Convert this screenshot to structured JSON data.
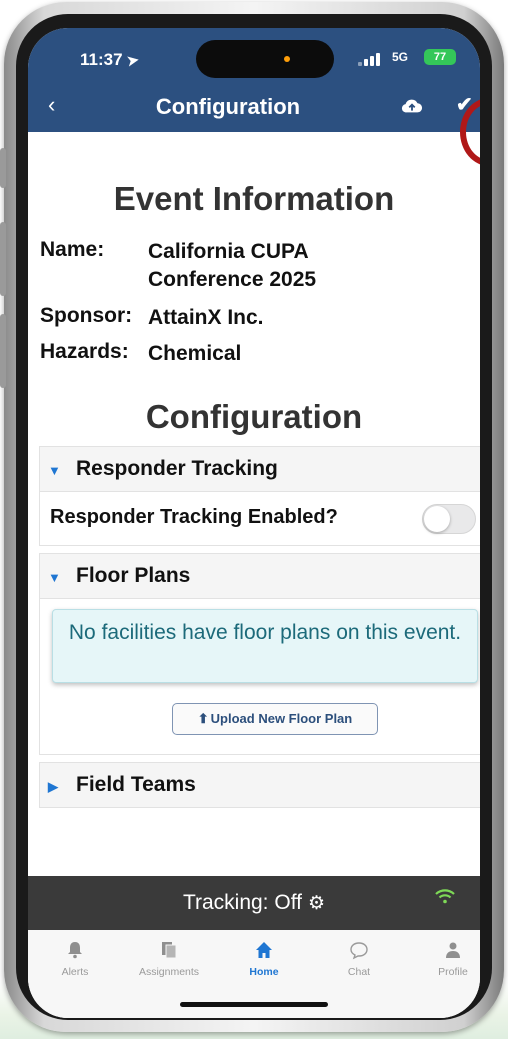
{
  "status_bar": {
    "time": "11:37",
    "network": "5G",
    "battery": "77"
  },
  "nav": {
    "title": "Configuration",
    "back_icon": "chevron-left-icon",
    "cloud_icon": "cloud-upload-icon",
    "confirm_icon": "checkmark-icon"
  },
  "event": {
    "heading": "Event Information",
    "name_label": "Name:",
    "name_value": "California CUPA Conference 2025",
    "sponsor_label": "Sponsor:",
    "sponsor_value": "AttainX Inc.",
    "hazards_label": "Hazards:",
    "hazards_value": "Chemical"
  },
  "configuration": {
    "heading": "Configuration",
    "sections": [
      {
        "title": "Responder Tracking",
        "expanded": true,
        "toggle_label": "Responder Tracking Enabled?",
        "toggle_on": false
      },
      {
        "title": "Floor Plans",
        "expanded": true,
        "notice": "No facilities have floor plans on this event.",
        "upload_label": "Upload New Floor Plan"
      },
      {
        "title": "Field Teams",
        "expanded": false
      }
    ]
  },
  "tracking_bar": {
    "label": "Tracking:",
    "value": "Off"
  },
  "tabs": [
    {
      "label": "Alerts",
      "icon": "bell-icon",
      "active": false
    },
    {
      "label": "Assignments",
      "icon": "documents-icon",
      "active": false
    },
    {
      "label": "Home",
      "icon": "home-icon",
      "active": true
    },
    {
      "label": "Chat",
      "icon": "chat-bubble-icon",
      "active": false
    },
    {
      "label": "Profile",
      "icon": "person-icon",
      "active": false
    }
  ],
  "colors": {
    "header": "#2c5080",
    "accent": "#1f76d2",
    "highlight_ring": "#b01818",
    "notice_bg": "#e6f6f8",
    "tracking_bar": "#3a3a3a"
  }
}
